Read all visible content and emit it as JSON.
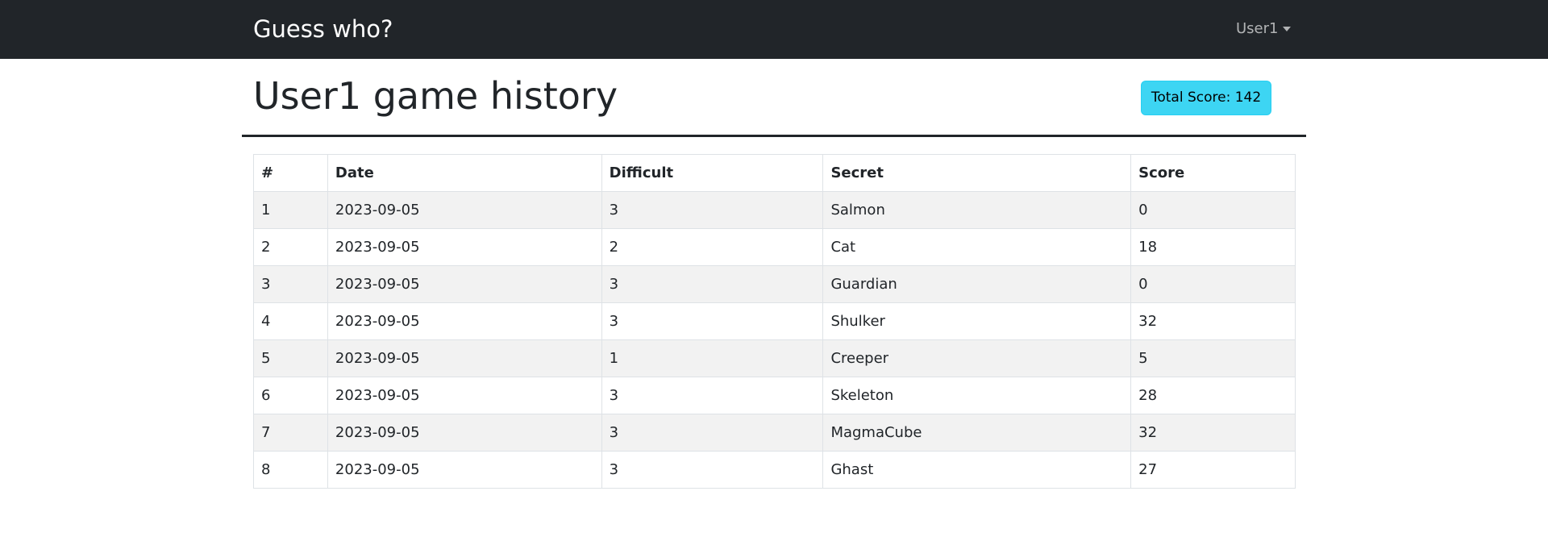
{
  "navbar": {
    "brand": "Guess who?",
    "user_menu": "User1"
  },
  "header": {
    "title": "User1 game history",
    "total_score_badge": "Total Score: 142"
  },
  "table": {
    "columns": [
      "#",
      "Date",
      "Difficult",
      "Secret",
      "Score"
    ],
    "rows": [
      [
        "1",
        "2023-09-05",
        "3",
        "Salmon",
        "0"
      ],
      [
        "2",
        "2023-09-05",
        "2",
        "Cat",
        "18"
      ],
      [
        "3",
        "2023-09-05",
        "3",
        "Guardian",
        "0"
      ],
      [
        "4",
        "2023-09-05",
        "3",
        "Shulker",
        "32"
      ],
      [
        "5",
        "2023-09-05",
        "1",
        "Creeper",
        "5"
      ],
      [
        "6",
        "2023-09-05",
        "3",
        "Skeleton",
        "28"
      ],
      [
        "7",
        "2023-09-05",
        "3",
        "MagmaCube",
        "32"
      ],
      [
        "8",
        "2023-09-05",
        "3",
        "Ghast",
        "27"
      ]
    ]
  },
  "colors": {
    "navbar_bg": "#212529",
    "badge_bg": "#3dd5f3",
    "striped_row": "#f2f2f2"
  }
}
